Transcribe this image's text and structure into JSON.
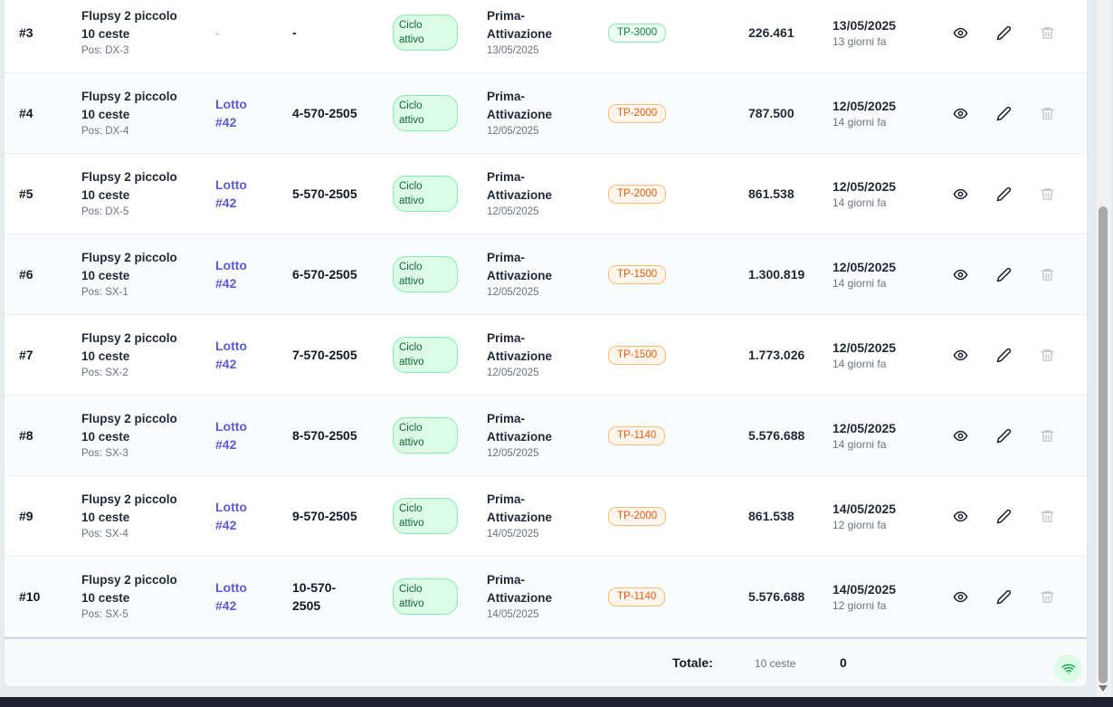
{
  "rows": [
    {
      "id": "#3",
      "basket_line1": "Flupsy 2 piccolo",
      "basket_line2": "10 ceste",
      "pos": "Pos: DX-3",
      "lot_line1": "",
      "lot_line2": "",
      "lot_empty": "-",
      "code_line1": "-",
      "code_line2": "",
      "status_line1": "Ciclo",
      "status_line2": "attivo",
      "op_line1": "Prima-",
      "op_line2": "Attivazione",
      "op_date": "13/05/2025",
      "size": "TP-3000",
      "size_color": "green",
      "count": "226.461",
      "date": "13/05/2025",
      "date_rel": "13 giorni fa"
    },
    {
      "id": "#4",
      "basket_line1": "Flupsy 2 piccolo",
      "basket_line2": "10 ceste",
      "pos": "Pos: DX-4",
      "lot_line1": "Lotto",
      "lot_line2": "#42",
      "lot_empty": "",
      "code_line1": "4-570-2505",
      "code_line2": "",
      "status_line1": "Ciclo",
      "status_line2": "attivo",
      "op_line1": "Prima-",
      "op_line2": "Attivazione",
      "op_date": "12/05/2025",
      "size": "TP-2000",
      "size_color": "orange",
      "count": "787.500",
      "date": "12/05/2025",
      "date_rel": "14 giorni fa"
    },
    {
      "id": "#5",
      "basket_line1": "Flupsy 2 piccolo",
      "basket_line2": "10 ceste",
      "pos": "Pos: DX-5",
      "lot_line1": "Lotto",
      "lot_line2": "#42",
      "lot_empty": "",
      "code_line1": "5-570-2505",
      "code_line2": "",
      "status_line1": "Ciclo",
      "status_line2": "attivo",
      "op_line1": "Prima-",
      "op_line2": "Attivazione",
      "op_date": "12/05/2025",
      "size": "TP-2000",
      "size_color": "orange",
      "count": "861.538",
      "date": "12/05/2025",
      "date_rel": "14 giorni fa"
    },
    {
      "id": "#6",
      "basket_line1": "Flupsy 2 piccolo",
      "basket_line2": "10 ceste",
      "pos": "Pos: SX-1",
      "lot_line1": "Lotto",
      "lot_line2": "#42",
      "lot_empty": "",
      "code_line1": "6-570-2505",
      "code_line2": "",
      "status_line1": "Ciclo",
      "status_line2": "attivo",
      "op_line1": "Prima-",
      "op_line2": "Attivazione",
      "op_date": "12/05/2025",
      "size": "TP-1500",
      "size_color": "orange",
      "count": "1.300.819",
      "date": "12/05/2025",
      "date_rel": "14 giorni fa"
    },
    {
      "id": "#7",
      "basket_line1": "Flupsy 2 piccolo",
      "basket_line2": "10 ceste",
      "pos": "Pos: SX-2",
      "lot_line1": "Lotto",
      "lot_line2": "#42",
      "lot_empty": "",
      "code_line1": "7-570-2505",
      "code_line2": "",
      "status_line1": "Ciclo",
      "status_line2": "attivo",
      "op_line1": "Prima-",
      "op_line2": "Attivazione",
      "op_date": "12/05/2025",
      "size": "TP-1500",
      "size_color": "orange",
      "count": "1.773.026",
      "date": "12/05/2025",
      "date_rel": "14 giorni fa"
    },
    {
      "id": "#8",
      "basket_line1": "Flupsy 2 piccolo",
      "basket_line2": "10 ceste",
      "pos": "Pos: SX-3",
      "lot_line1": "Lotto",
      "lot_line2": "#42",
      "lot_empty": "",
      "code_line1": "8-570-2505",
      "code_line2": "",
      "status_line1": "Ciclo",
      "status_line2": "attivo",
      "op_line1": "Prima-",
      "op_line2": "Attivazione",
      "op_date": "12/05/2025",
      "size": "TP-1140",
      "size_color": "orange",
      "count": "5.576.688",
      "date": "12/05/2025",
      "date_rel": "14 giorni fa"
    },
    {
      "id": "#9",
      "basket_line1": "Flupsy 2 piccolo",
      "basket_line2": "10 ceste",
      "pos": "Pos: SX-4",
      "lot_line1": "Lotto",
      "lot_line2": "#42",
      "lot_empty": "",
      "code_line1": "9-570-2505",
      "code_line2": "",
      "status_line1": "Ciclo",
      "status_line2": "attivo",
      "op_line1": "Prima-",
      "op_line2": "Attivazione",
      "op_date": "14/05/2025",
      "size": "TP-2000",
      "size_color": "orange",
      "count": "861.538",
      "date": "14/05/2025",
      "date_rel": "12 giorni fa"
    },
    {
      "id": "#10",
      "basket_line1": "Flupsy 2 piccolo",
      "basket_line2": "10 ceste",
      "pos": "Pos: SX-5",
      "lot_line1": "Lotto",
      "lot_line2": "#42",
      "lot_empty": "",
      "code_line1": "10-570-",
      "code_line2": "2505",
      "status_line1": "Ciclo",
      "status_line2": "attivo",
      "op_line1": "Prima-",
      "op_line2": "Attivazione",
      "op_date": "14/05/2025",
      "size": "TP-1140",
      "size_color": "orange",
      "count": "5.576.688",
      "date": "14/05/2025",
      "date_rel": "12 giorni fa"
    }
  ],
  "footer": {
    "label": "Totale:",
    "baskets": "10 ceste",
    "total": "0"
  },
  "icons": {
    "view": "eye-icon",
    "edit": "pencil-icon",
    "delete": "trash-icon",
    "connection": "wifi-icon"
  },
  "colors": {
    "link": "#5b5bd6",
    "status_bg": "#dcfce7",
    "size_green": "#15803d",
    "size_orange": "#ea580c",
    "delete_disabled": "#c4c7cc"
  }
}
